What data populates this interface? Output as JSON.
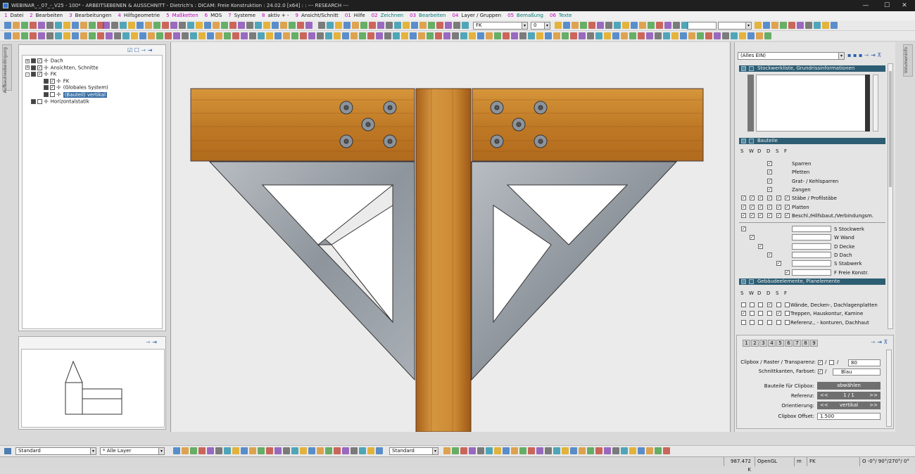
{
  "window": {
    "title": "WEBINAR_-_07_-_V25 - 100* - ARBEITSEBENEN & AUSSCHNITT - Dietrich's : DICAM: Freie Konstruktion : 24.02.0 [x64] : : --- RESEARCH ---"
  },
  "menu": [
    {
      "num": "1",
      "label": "Datei",
      "style": "normal"
    },
    {
      "num": "2",
      "label": "Bearbeiten",
      "style": "normal"
    },
    {
      "num": "3",
      "label": "Bearbeitungen",
      "style": "normal"
    },
    {
      "num": "4",
      "label": "Hilfsgeometrie",
      "style": "normal"
    },
    {
      "num": "5",
      "label": "Maßketten",
      "style": "magenta"
    },
    {
      "num": "6",
      "label": "MOS",
      "style": "normal"
    },
    {
      "num": "7",
      "label": "Systeme",
      "style": "normal"
    },
    {
      "num": "8",
      "label": "aktiv + -",
      "style": "normal"
    },
    {
      "num": "9",
      "label": "Ansicht/Schnitt",
      "style": "normal"
    },
    {
      "num": "01",
      "label": "Hilfe",
      "style": "normal"
    },
    {
      "num": "02",
      "label": "Zeichnen",
      "style": "teal"
    },
    {
      "num": "03",
      "label": "Bearbeiten",
      "style": "teal"
    },
    {
      "num": "04",
      "label": "Layer / Gruppen",
      "style": "normal"
    },
    {
      "num": "05",
      "label": "Bemaßung",
      "style": "teal"
    },
    {
      "num": "06",
      "label": "Texte",
      "style": "teal"
    }
  ],
  "toolbar1": {
    "fk_select": "FK",
    "num_select": "0"
  },
  "side_tabs": {
    "left": "Aufbautreebedingung",
    "right": "Volumeninfo"
  },
  "tree": {
    "items": [
      {
        "label": "Dach",
        "expand": "+",
        "checked": true,
        "level": 0,
        "selected": false
      },
      {
        "label": "Ansichten, Schnitte",
        "expand": "+",
        "checked": true,
        "level": 0,
        "selected": false
      },
      {
        "label": "FK",
        "expand": "-",
        "checked": true,
        "level": 0,
        "selected": false
      },
      {
        "label": "FK",
        "expand": "",
        "checked": true,
        "level": 1,
        "selected": false
      },
      {
        "label": "(Globales System)",
        "expand": "",
        "checked": true,
        "level": 1,
        "selected": false
      },
      {
        "label": "(Bauteil) vertikal",
        "expand": "",
        "checked": false,
        "level": 1,
        "selected": true
      },
      {
        "label": "Horizontalstatik",
        "expand": "",
        "checked": false,
        "level": 0,
        "selected": false
      }
    ]
  },
  "right_panel": {
    "filter_select": "(Alles EIN)",
    "section1_title": "Stockwerkliste, Grundrissinformationen",
    "section2_title": "Bauteile",
    "section3_title": "Gebäudeelemente, Planelemente",
    "col_headers": [
      "S",
      "W",
      "D",
      "D",
      "S",
      "F"
    ],
    "bauteile": [
      {
        "label": "Sparren",
        "checks": [
          false,
          false,
          false,
          true,
          false,
          false
        ]
      },
      {
        "label": "Pfetten",
        "checks": [
          false,
          false,
          false,
          true,
          false,
          false
        ]
      },
      {
        "label": "Grat- / Kehlsparren",
        "checks": [
          false,
          false,
          false,
          true,
          false,
          false
        ]
      },
      {
        "label": "Zangen",
        "checks": [
          false,
          false,
          false,
          true,
          false,
          false
        ]
      },
      {
        "label": "Stäbe / Profilstäbe",
        "checks": [
          true,
          true,
          true,
          true,
          true,
          true
        ]
      },
      {
        "label": "Platten",
        "checks": [
          true,
          true,
          true,
          true,
          true,
          true
        ]
      },
      {
        "label": "Beschl./Hilfsbaut./Verbindungsm.",
        "checks": [
          true,
          true,
          true,
          true,
          true,
          true
        ]
      }
    ],
    "stockwerke": [
      {
        "label": "S Stockwerk",
        "col": 0
      },
      {
        "label": "W Wand",
        "col": 1
      },
      {
        "label": "D Decke",
        "col": 2
      },
      {
        "label": "D Dach",
        "col": 3
      },
      {
        "label": "S Stabwerk",
        "col": 4
      },
      {
        "label": "F Freie Konstr.",
        "col": 5
      }
    ],
    "gebaeude": [
      {
        "label": "Wände, Decken-, Dachlagenplatten",
        "checks": [
          false,
          false,
          false,
          true,
          false,
          false
        ]
      },
      {
        "label": "Treppen, Hauskontur, Kamine",
        "checks": [
          true,
          false,
          false,
          false,
          true,
          false
        ]
      },
      {
        "label": "Referenz., - konturen, Dachhaut",
        "checks": [
          false,
          false,
          false,
          false,
          false,
          false
        ]
      }
    ],
    "number_tabs": [
      "1",
      "2",
      "3",
      "4",
      "5",
      "6",
      "7",
      "8",
      "9"
    ],
    "clipbox": {
      "transparenz_label": "Clipbox / Raster / Transparenz:",
      "transparenz_value": "80",
      "schnittkanten_label": "Schnittkanten, Farbset:",
      "farbset": "Blau",
      "bauteile_label": "Bauteile für Clipbox:",
      "bauteile_btn": "abwählen",
      "referenz_label": "Referenz:",
      "referenz_value": "1 / 1",
      "orientierung_label": "Orientierung:",
      "orientierung_value": "vertikal",
      "offset_label": "Clipbox Offset:",
      "offset_value": "1.500",
      "prev": "<<",
      "next": ">>"
    }
  },
  "bottom_toolbar": {
    "style_select": "Standard",
    "layer_select": "* Alle Layer",
    "style_select2": "Standard"
  },
  "status": {
    "coords": "987.472 K",
    "renderer": "OpenGL",
    "unit": "m",
    "system": "FK",
    "angles": "O -0°/ 90°/270°/ 0°"
  }
}
